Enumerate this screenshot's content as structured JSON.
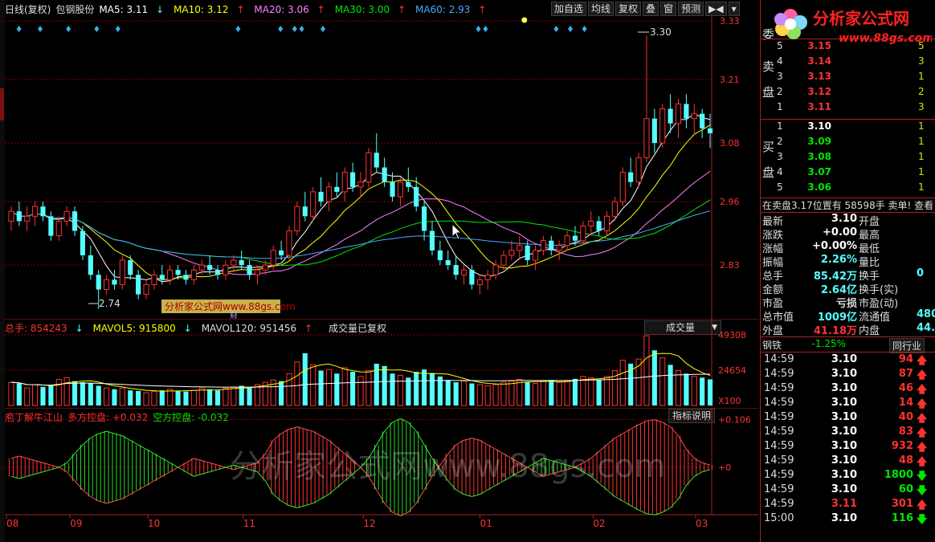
{
  "header": {
    "chart_type": "日线(复权)",
    "stock_name": "包钢股份",
    "ma5": "MA5: 3.11",
    "ma10": "MA10: 3.12",
    "ma20": "MA20: 3.06",
    "ma30": "MA30: 3.00",
    "ma60": "MA60: 2.93",
    "arrow_down": "↓",
    "arrow_up": "↑"
  },
  "toolbar": [
    "加自选",
    "均线",
    "复权",
    "叠",
    "窗",
    "预测",
    "▶◀"
  ],
  "colors": {
    "up": "#ff3232",
    "down": "#54ffff",
    "ma5": "#ffffff",
    "ma10": "#ffff00",
    "ma20": "#ff80ff",
    "ma30": "#00e600",
    "ma60": "#4aa8ff",
    "grid": "#8b0000"
  },
  "main_chart": {
    "y_ticks": [
      "3.33",
      "3.21",
      "3.08",
      "2.96",
      "2.83"
    ],
    "high_label": "3.30",
    "low_label": "2.74",
    "watermark_box": "分析家公式网www.88gs.com",
    "small_char": "财"
  },
  "volume": {
    "total_label": "总手: 854243",
    "mavol5": "MAVOL5: 915800",
    "mavol120": "MAVOL120: 951456",
    "note": "成交量已复权",
    "dropdown": "成交量",
    "y_ticks": [
      "49308",
      "24654",
      "X100"
    ]
  },
  "indicator": {
    "name": "庖丁解牛江山",
    "duo_label": "多方控盘: +0.032",
    "kong_label": "空方控盘: -0.032",
    "button": "指标说明",
    "y_ticks": [
      "+0.106",
      "+0"
    ],
    "watermark": "分析家公式网www.88gs.com"
  },
  "x_axis": [
    "08",
    "09",
    "10",
    "11",
    "12",
    "01",
    "02",
    "03"
  ],
  "logo": {
    "text": "分析家公式网",
    "url": "www.88gs.com"
  },
  "orderbook": {
    "weibi_label": "委",
    "sell_side": [
      "卖",
      "盘"
    ],
    "buy_side": [
      "买",
      "盘"
    ],
    "sell": [
      {
        "lvl": "5",
        "price": "3.15",
        "vol": "5"
      },
      {
        "lvl": "4",
        "price": "3.14",
        "vol": "3"
      },
      {
        "lvl": "3",
        "price": "3.13",
        "vol": "1"
      },
      {
        "lvl": "2",
        "price": "3.12",
        "vol": "2"
      },
      {
        "lvl": "1",
        "price": "3.11",
        "vol": "3"
      }
    ],
    "buy": [
      {
        "lvl": "1",
        "price": "3.10",
        "vol": "1"
      },
      {
        "lvl": "2",
        "price": "3.09",
        "vol": "1"
      },
      {
        "lvl": "3",
        "price": "3.08",
        "vol": "1"
      },
      {
        "lvl": "4",
        "price": "3.07",
        "vol": "1"
      },
      {
        "lvl": "5",
        "price": "3.06",
        "vol": "1"
      }
    ]
  },
  "ticker_line": "在卖盘3.17位置有 58598手 卖单! 查看",
  "quote": [
    {
      "k": "最新",
      "v": "3.10",
      "k2": "开盘",
      "v2": ""
    },
    {
      "k": "涨跌",
      "v": "+0.00",
      "k2": "最高",
      "v2": ""
    },
    {
      "k": "涨幅",
      "v": "+0.00%",
      "k2": "最低",
      "v2": ""
    },
    {
      "k": "振幅",
      "v": "2.26%",
      "k2": "量比",
      "v2": ""
    },
    {
      "k": "总手",
      "v": "85.42万",
      "k2": "换手",
      "v2": "0"
    },
    {
      "k": "金额",
      "v": "2.64亿",
      "k2": "换手(实)",
      "v2": ""
    },
    {
      "k": "市盈",
      "v": "亏损",
      "k2": "市盈(动)",
      "v2": ""
    },
    {
      "k": "总市值",
      "v": "1009亿",
      "k2": "流通值",
      "v2": "480"
    },
    {
      "k": "外盘",
      "v": "41.18万",
      "k2": "内盘",
      "v2": "44."
    }
  ],
  "sector": {
    "name": "钢铁",
    "change": "-1.25%",
    "button": "同行业"
  },
  "ticks": [
    {
      "t": "14:59",
      "p": "3.10",
      "q": "94",
      "dir": "up"
    },
    {
      "t": "14:59",
      "p": "3.10",
      "q": "87",
      "dir": "up"
    },
    {
      "t": "14:59",
      "p": "3.10",
      "q": "46",
      "dir": "up"
    },
    {
      "t": "14:59",
      "p": "3.10",
      "q": "14",
      "dir": "up"
    },
    {
      "t": "14:59",
      "p": "3.10",
      "q": "40",
      "dir": "up"
    },
    {
      "t": "14:59",
      "p": "3.10",
      "q": "83",
      "dir": "up"
    },
    {
      "t": "14:59",
      "p": "3.10",
      "q": "932",
      "dir": "up"
    },
    {
      "t": "14:59",
      "p": "3.10",
      "q": "48",
      "dir": "up"
    },
    {
      "t": "14:59",
      "p": "3.10",
      "q": "1800",
      "dir": "down"
    },
    {
      "t": "14:59",
      "p": "3.10",
      "q": "60",
      "dir": "down"
    },
    {
      "t": "14:59",
      "p": "3.11",
      "q": "301",
      "dir": "up"
    },
    {
      "t": "15:00",
      "p": "3.10",
      "q": "116",
      "dir": "down"
    }
  ],
  "chart_data": {
    "type": "candlestick",
    "ylim": [
      2.72,
      3.34
    ],
    "ohlc": [
      [
        2.92,
        2.95,
        2.9,
        2.94
      ],
      [
        2.94,
        2.96,
        2.91,
        2.92
      ],
      [
        2.92,
        2.95,
        2.9,
        2.93
      ],
      [
        2.93,
        2.96,
        2.91,
        2.95
      ],
      [
        2.95,
        2.96,
        2.92,
        2.93
      ],
      [
        2.93,
        2.94,
        2.88,
        2.89
      ],
      [
        2.89,
        2.93,
        2.88,
        2.92
      ],
      [
        2.92,
        2.95,
        2.91,
        2.94
      ],
      [
        2.94,
        2.95,
        2.89,
        2.9
      ],
      [
        2.9,
        2.91,
        2.84,
        2.85
      ],
      [
        2.85,
        2.87,
        2.8,
        2.81
      ],
      [
        2.81,
        2.82,
        2.74,
        2.78
      ],
      [
        2.78,
        2.81,
        2.77,
        2.8
      ],
      [
        2.8,
        2.82,
        2.78,
        2.79
      ],
      [
        2.79,
        2.85,
        2.78,
        2.84
      ],
      [
        2.84,
        2.85,
        2.8,
        2.81
      ],
      [
        2.81,
        2.82,
        2.76,
        2.77
      ],
      [
        2.77,
        2.8,
        2.76,
        2.79
      ],
      [
        2.79,
        2.82,
        2.78,
        2.81
      ],
      [
        2.81,
        2.83,
        2.79,
        2.8
      ],
      [
        2.8,
        2.83,
        2.79,
        2.82
      ],
      [
        2.82,
        2.83,
        2.8,
        2.81
      ],
      [
        2.81,
        2.82,
        2.79,
        2.8
      ],
      [
        2.8,
        2.83,
        2.79,
        2.82
      ],
      [
        2.82,
        2.84,
        2.81,
        2.83
      ],
      [
        2.83,
        2.85,
        2.81,
        2.82
      ],
      [
        2.82,
        2.83,
        2.8,
        2.81
      ],
      [
        2.81,
        2.84,
        2.8,
        2.83
      ],
      [
        2.83,
        2.85,
        2.82,
        2.84
      ],
      [
        2.84,
        2.86,
        2.82,
        2.83
      ],
      [
        2.83,
        2.84,
        2.8,
        2.81
      ],
      [
        2.81,
        2.83,
        2.79,
        2.82
      ],
      [
        2.82,
        2.84,
        2.81,
        2.83
      ],
      [
        2.83,
        2.87,
        2.82,
        2.86
      ],
      [
        2.86,
        2.88,
        2.84,
        2.85
      ],
      [
        2.85,
        2.91,
        2.84,
        2.9
      ],
      [
        2.9,
        2.96,
        2.89,
        2.95
      ],
      [
        2.95,
        2.98,
        2.92,
        2.93
      ],
      [
        2.93,
        2.99,
        2.92,
        2.98
      ],
      [
        2.98,
        3.01,
        2.95,
        2.96
      ],
      [
        2.96,
        3.0,
        2.94,
        2.99
      ],
      [
        2.99,
        3.02,
        2.97,
        2.98
      ],
      [
        2.98,
        3.03,
        2.96,
        3.02
      ],
      [
        3.02,
        3.04,
        2.98,
        2.99
      ],
      [
        2.99,
        3.02,
        2.97,
        3.0
      ],
      [
        3.0,
        3.07,
        2.99,
        3.06
      ],
      [
        3.06,
        3.1,
        3.02,
        3.03
      ],
      [
        3.03,
        3.05,
        2.99,
        3.0
      ],
      [
        3.0,
        3.02,
        2.96,
        2.97
      ],
      [
        2.97,
        3.01,
        2.95,
        3.0
      ],
      [
        3.0,
        3.03,
        2.98,
        2.99
      ],
      [
        2.99,
        3.01,
        2.94,
        2.95
      ],
      [
        2.95,
        2.96,
        2.88,
        2.9
      ],
      [
        2.9,
        2.92,
        2.85,
        2.86
      ],
      [
        2.86,
        2.88,
        2.83,
        2.84
      ],
      [
        2.84,
        2.86,
        2.82,
        2.83
      ],
      [
        2.83,
        2.85,
        2.8,
        2.81
      ],
      [
        2.81,
        2.83,
        2.79,
        2.82
      ],
      [
        2.82,
        2.83,
        2.78,
        2.79
      ],
      [
        2.79,
        2.81,
        2.77,
        2.8
      ],
      [
        2.8,
        2.82,
        2.78,
        2.81
      ],
      [
        2.81,
        2.84,
        2.8,
        2.83
      ],
      [
        2.83,
        2.86,
        2.82,
        2.85
      ],
      [
        2.85,
        2.88,
        2.84,
        2.86
      ],
      [
        2.86,
        2.89,
        2.84,
        2.87
      ],
      [
        2.87,
        2.88,
        2.83,
        2.84
      ],
      [
        2.84,
        2.87,
        2.82,
        2.86
      ],
      [
        2.86,
        2.89,
        2.85,
        2.88
      ],
      [
        2.88,
        2.89,
        2.85,
        2.86
      ],
      [
        2.86,
        2.88,
        2.84,
        2.87
      ],
      [
        2.87,
        2.9,
        2.86,
        2.89
      ],
      [
        2.89,
        2.91,
        2.87,
        2.88
      ],
      [
        2.88,
        2.92,
        2.87,
        2.91
      ],
      [
        2.91,
        2.94,
        2.89,
        2.92
      ],
      [
        2.92,
        2.93,
        2.89,
        2.9
      ],
      [
        2.9,
        2.94,
        2.89,
        2.93
      ],
      [
        2.93,
        2.97,
        2.92,
        2.96
      ],
      [
        2.96,
        3.03,
        2.95,
        3.02
      ],
      [
        3.02,
        3.05,
        2.99,
        3.0
      ],
      [
        3.0,
        3.06,
        2.99,
        3.05
      ],
      [
        3.05,
        3.3,
        3.04,
        3.13
      ],
      [
        3.13,
        3.15,
        3.06,
        3.08
      ],
      [
        3.08,
        3.16,
        3.07,
        3.15
      ],
      [
        3.15,
        3.18,
        3.1,
        3.12
      ],
      [
        3.12,
        3.17,
        3.09,
        3.16
      ],
      [
        3.16,
        3.18,
        3.11,
        3.13
      ],
      [
        3.13,
        3.16,
        3.1,
        3.14
      ],
      [
        3.14,
        3.15,
        3.09,
        3.11
      ],
      [
        3.11,
        3.14,
        3.07,
        3.1
      ]
    ],
    "volume": [
      40,
      38,
      30,
      36,
      32,
      35,
      45,
      48,
      42,
      40,
      38,
      34,
      30,
      28,
      30,
      26,
      25,
      22,
      24,
      26,
      28,
      25,
      24,
      26,
      30,
      28,
      26,
      30,
      32,
      34,
      30,
      36,
      40,
      44,
      42,
      55,
      75,
      90,
      70,
      60,
      62,
      55,
      65,
      58,
      50,
      60,
      72,
      68,
      55,
      52,
      48,
      58,
      62,
      56,
      50,
      44,
      40,
      42,
      38,
      36,
      34,
      36,
      40,
      42,
      45,
      40,
      38,
      42,
      44,
      40,
      42,
      46,
      50,
      48,
      44,
      50,
      60,
      78,
      72,
      80,
      120,
      95,
      82,
      70,
      60,
      55,
      50,
      48,
      45
    ],
    "indicator": [
      0.02,
      0.025,
      0.02,
      0.015,
      0.01,
      0.005,
      0.0,
      -0.01,
      -0.03,
      -0.05,
      -0.065,
      -0.075,
      -0.08,
      -0.075,
      -0.07,
      -0.06,
      -0.05,
      -0.04,
      -0.03,
      -0.02,
      -0.01,
      0.0,
      0.01,
      0.02,
      0.015,
      0.01,
      0.005,
      0.0,
      -0.005,
      0.0,
      0.005,
      0.01,
      0.03,
      0.06,
      0.075,
      0.085,
      0.09,
      0.085,
      0.08,
      0.07,
      0.06,
      0.045,
      0.03,
      0.015,
      0.0,
      -0.02,
      -0.05,
      -0.08,
      -0.1,
      -0.108,
      -0.1,
      -0.08,
      -0.05,
      -0.02,
      0.005,
      0.03,
      0.05,
      0.06,
      0.065,
      0.06,
      0.05,
      0.04,
      0.03,
      0.02,
      0.01,
      0.0,
      -0.01,
      -0.02,
      -0.015,
      -0.01,
      -0.005,
      0.0,
      0.01,
      0.02,
      0.035,
      0.05,
      0.065,
      0.075,
      0.085,
      0.095,
      0.103,
      0.106,
      0.1,
      0.09,
      0.07,
      0.04,
      0.02,
      0.01,
      0.005
    ]
  }
}
